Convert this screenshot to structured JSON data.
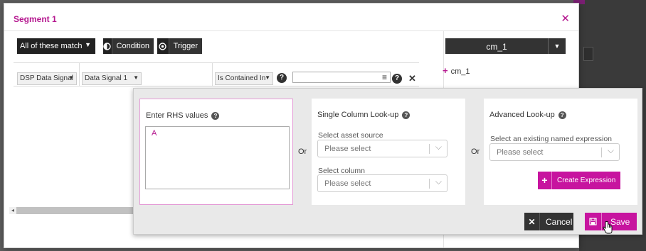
{
  "modal": {
    "title": "Segment 1",
    "close_icon": "close-icon"
  },
  "toolbar": {
    "match_label": "All of these match",
    "condition_label": "Condition",
    "trigger_label": "Trigger"
  },
  "right_pane": {
    "cm_select_value": "cm_1",
    "cm_items": [
      "cm_1"
    ]
  },
  "condition_row": {
    "signal_type": "DSP Data Signal",
    "signal_name": "Data Signal 1",
    "operator": "Is Contained In",
    "rhs_value": ""
  },
  "popup": {
    "rhs_panel": {
      "title": "Enter RHS values",
      "value": "A"
    },
    "or_label": "Or",
    "single_column": {
      "title": "Single Column Look-up",
      "asset_source_label": "Select asset source",
      "asset_source_placeholder": "Please select",
      "column_label": "Select column",
      "column_placeholder": "Please select"
    },
    "advanced": {
      "title": "Advanced Look-up",
      "expression_label": "Select an existing named expression",
      "expression_placeholder": "Please select",
      "create_label": "Create Expression"
    },
    "cancel_label": "Cancel",
    "save_label": "Save"
  },
  "colors": {
    "accent": "#c7149f",
    "title_accent": "#b5178f",
    "dark_button": "#333333"
  }
}
